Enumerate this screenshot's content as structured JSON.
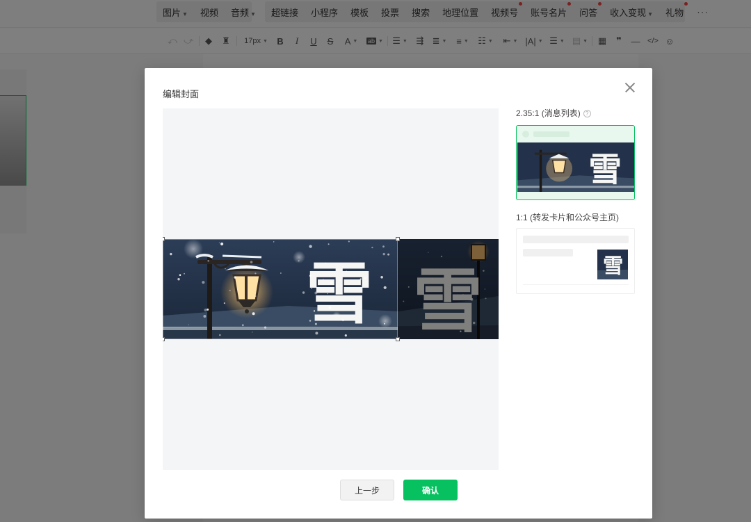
{
  "toolbar": {
    "insert_items": [
      {
        "label": "图片",
        "caret": true,
        "dot": false
      },
      {
        "label": "视频",
        "caret": false,
        "dot": false
      },
      {
        "label": "音频",
        "caret": true,
        "dot": false
      },
      {
        "label": "超链接",
        "caret": false,
        "dot": false
      },
      {
        "label": "小程序",
        "caret": false,
        "dot": false
      },
      {
        "label": "模板",
        "caret": false,
        "dot": false
      },
      {
        "label": "投票",
        "caret": false,
        "dot": false
      },
      {
        "label": "搜索",
        "caret": false,
        "dot": false
      },
      {
        "label": "地理位置",
        "caret": false,
        "dot": false
      },
      {
        "label": "视频号",
        "caret": false,
        "dot": true
      },
      {
        "label": "账号名片",
        "caret": false,
        "dot": true
      },
      {
        "label": "问答",
        "caret": false,
        "dot": true
      },
      {
        "label": "收入变现",
        "caret": true,
        "dot": false
      },
      {
        "label": "礼物",
        "caret": false,
        "dot": true
      }
    ],
    "more_label": "···",
    "font_size": "17px",
    "dot_color": "#e64340"
  },
  "format_icons": [
    "undo-icon",
    "redo-icon",
    "format-painter-icon",
    "clear-format-icon",
    "bold-icon",
    "italic-icon",
    "underline-icon",
    "strikethrough-icon",
    "font-color-icon",
    "background-color-icon",
    "align-icon",
    "indent-icon",
    "line-height-icon",
    "letter-spacing-icon",
    "paragraph-spacing-icon",
    "text-direction-icon",
    "list-icon",
    "blockquote-style-icon",
    "table-icon",
    "quote-icon",
    "divider-icon",
    "code-icon",
    "emoji-icon"
  ],
  "modal": {
    "title": "编辑封面",
    "ratio_wide_label": "2.35:1 (消息列表)",
    "ratio_square_label": "1:1 (转发卡片和公众号主页)",
    "help_glyph": "?",
    "prev_button": "上一步",
    "confirm_button": "确认",
    "accent_color": "#07c160"
  },
  "cover_image": {
    "character": "雪",
    "description_icons": [
      "street-lamp",
      "snowfall"
    ]
  }
}
